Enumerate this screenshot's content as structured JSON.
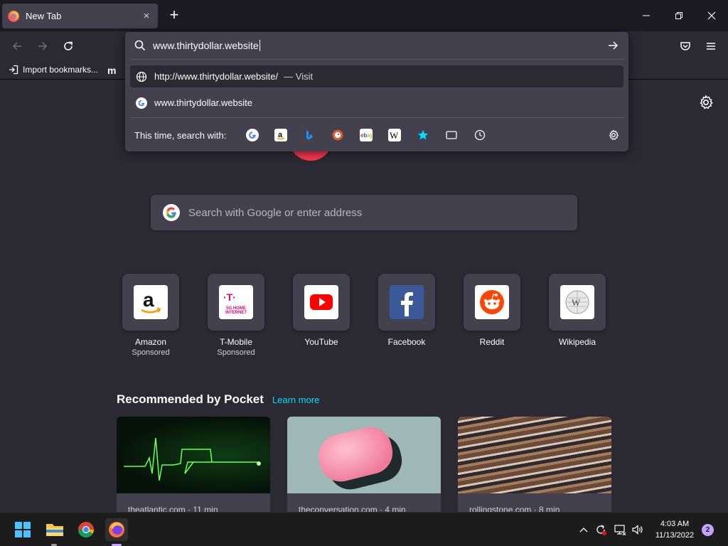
{
  "tab": {
    "title": "New Tab",
    "close": "×"
  },
  "new_tab_symbol": "+",
  "urlbar": {
    "value": "www.thirtydollar.website",
    "results": [
      {
        "text": "http://www.thirtydollar.website/",
        "action": "— Visit"
      },
      {
        "text": "www.thirtydollar.website"
      }
    ],
    "one_off_label": "This time, search with:",
    "engines": [
      "google-icon",
      "amazon-icon",
      "bing-icon",
      "duckduckgo-icon",
      "ebay-icon",
      "wikipedia-icon",
      "bookmarks-icon",
      "tabs-icon",
      "history-icon"
    ]
  },
  "bookmarks": {
    "import": "Import bookmarks...",
    "second": "m"
  },
  "search": {
    "placeholder": "Search with Google or enter address"
  },
  "top_sites": [
    {
      "name": "Amazon",
      "sponsored": "Sponsored"
    },
    {
      "name": "T-Mobile",
      "sponsored": "Sponsored",
      "tile_text": "5G HOME INTERNET"
    },
    {
      "name": "YouTube"
    },
    {
      "name": "Facebook"
    },
    {
      "name": "Reddit"
    },
    {
      "name": "Wikipedia"
    }
  ],
  "pocket": {
    "heading": "Recommended by Pocket",
    "learn_more": "Learn more",
    "cards": [
      {
        "source": "theatlantic.com · 11 min"
      },
      {
        "source": "theconversation.com · 4 min"
      },
      {
        "source": "rollingstone.com · 8 min"
      }
    ]
  },
  "taskbar": {
    "time": "4:03 AM",
    "date": "11/13/2022",
    "notifications": "2"
  }
}
